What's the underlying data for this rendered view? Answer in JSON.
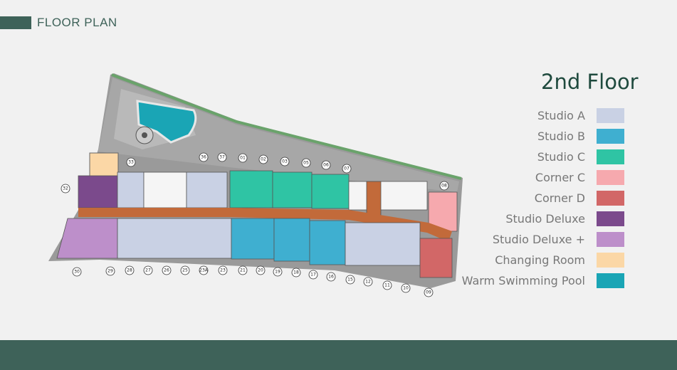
{
  "header": {
    "title": "FLOOR PLAN"
  },
  "floor": {
    "title": "2nd Floor"
  },
  "legend": [
    {
      "label": "Studio A",
      "color": "#c9d1e4"
    },
    {
      "label": "Studio B",
      "color": "#3fafd0"
    },
    {
      "label": "Studio C",
      "color": "#2fc4a4"
    },
    {
      "label": "Corner C",
      "color": "#f6a9ae"
    },
    {
      "label": "Corner D",
      "color": "#d26767"
    },
    {
      "label": "Studio Deluxe",
      "color": "#7b4a8c"
    },
    {
      "label": "Studio Deluxe +",
      "color": "#bd8fca"
    },
    {
      "label": "Changing Room",
      "color": "#fbd7a6"
    },
    {
      "label": "Warm Swimming Pool",
      "color": "#1aa5b5"
    }
  ],
  "unit_numbers": {
    "top": [
      "33",
      "36",
      "37",
      "01",
      "02",
      "03",
      "05",
      "06",
      "07"
    ],
    "side": [
      "32",
      "08"
    ],
    "bottom": [
      "30",
      "29",
      "28",
      "27",
      "26",
      "25",
      "23A",
      "23",
      "21",
      "20",
      "19",
      "18",
      "17",
      "16",
      "15",
      "12",
      "11",
      "10",
      "09"
    ]
  },
  "icons": {
    "pool": "pool-icon",
    "stairs": "spiral-stair-icon"
  }
}
